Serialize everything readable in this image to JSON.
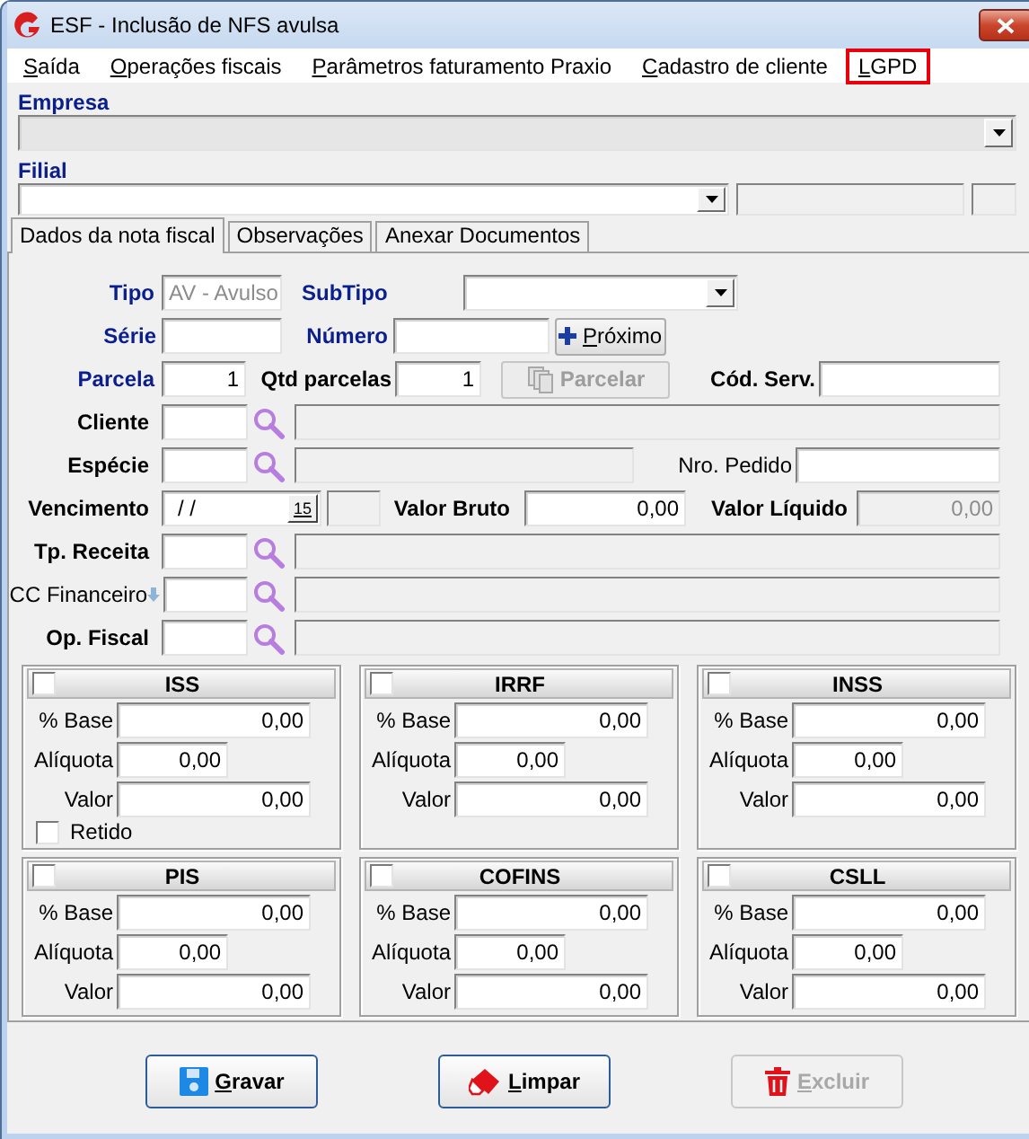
{
  "window": {
    "title": "ESF - Inclusão de NFS avulsa"
  },
  "menu": [
    {
      "label": "Saída",
      "highlighted": false
    },
    {
      "label": "Operações fiscais",
      "highlighted": false
    },
    {
      "label": "Parâmetros faturamento Praxio",
      "highlighted": false
    },
    {
      "label": "Cadastro de cliente",
      "highlighted": false
    },
    {
      "label": "LGPD",
      "highlighted": true
    }
  ],
  "empresa": {
    "label": "Empresa",
    "disabled": true
  },
  "filial": {
    "label": "Filial",
    "disabled": false
  },
  "tabs": [
    {
      "label": "Dados da nota fiscal",
      "selected": true
    },
    {
      "label": "Observações",
      "selected": false
    },
    {
      "label": "Anexar Documentos",
      "selected": false
    }
  ],
  "rows": [
    [
      {
        "kind": "label",
        "text": "Tipo"
      },
      {
        "kind": "input",
        "value": "AV - Avulso",
        "disabled": true
      },
      {
        "kind": "label",
        "text": "SubTipo"
      },
      {
        "kind": "combo"
      }
    ],
    [
      {
        "kind": "label",
        "text": "Série"
      },
      {
        "kind": "input"
      },
      {
        "kind": "label",
        "text": "Número"
      },
      {
        "kind": "input"
      },
      {
        "kind": "button",
        "label": "Próximo",
        "disabled": false
      }
    ],
    [
      {
        "kind": "label",
        "text": "Parcela"
      },
      {
        "kind": "input",
        "value": "1",
        "disabled": false
      },
      {
        "kind": "label",
        "text": "Qtd parcelas"
      },
      {
        "kind": "input",
        "value": "1",
        "disabled": false
      },
      {
        "kind": "button",
        "label": "Parcelar",
        "disabled": true
      },
      {
        "kind": "label",
        "text": "Cód. Serv."
      },
      {
        "kind": "input"
      }
    ],
    [
      {
        "kind": "label",
        "text": "Cliente"
      },
      {
        "kind": "input"
      },
      {
        "kind": "lookup"
      },
      {
        "kind": "display"
      }
    ],
    [
      {
        "kind": "label",
        "text": "Espécie"
      },
      {
        "kind": "input"
      },
      {
        "kind": "lookup"
      },
      {
        "kind": "display"
      },
      {
        "kind": "label",
        "text": "Nro. Pedido"
      },
      {
        "kind": "input"
      }
    ],
    [
      {
        "kind": "label",
        "text": "Vencimento"
      },
      {
        "kind": "date",
        "value": "/ /",
        "calendar": "15"
      },
      {
        "kind": "display"
      },
      {
        "kind": "label",
        "text": "Valor Bruto"
      },
      {
        "kind": "input",
        "value": "0,00",
        "disabled": false
      },
      {
        "kind": "label",
        "text": "Valor Líquido"
      },
      {
        "kind": "input",
        "value": "0,00",
        "disabled": true
      }
    ],
    [
      {
        "kind": "label",
        "text": "Tp. Receita"
      },
      {
        "kind": "input"
      },
      {
        "kind": "lookup"
      },
      {
        "kind": "display"
      }
    ],
    [
      {
        "kind": "label",
        "text": "CC Financeiro"
      },
      {
        "kind": "input"
      },
      {
        "kind": "lookup"
      },
      {
        "kind": "display"
      }
    ],
    [
      {
        "kind": "label",
        "text": "Op. Fiscal"
      },
      {
        "kind": "input"
      },
      {
        "kind": "lookup"
      },
      {
        "kind": "display"
      }
    ]
  ],
  "taxes": [
    {
      "name": "ISS",
      "checked": false,
      "fields": [
        {
          "label": "% Base",
          "value": "0,00"
        },
        {
          "label": "Alíquota",
          "value": "0,00"
        },
        {
          "label": "Valor",
          "value": "0,00"
        }
      ],
      "retido": {
        "label": "Retido",
        "checked": false
      }
    },
    {
      "name": "IRRF",
      "checked": false,
      "fields": [
        {
          "label": "% Base",
          "value": "0,00"
        },
        {
          "label": "Alíquota",
          "value": "0,00"
        },
        {
          "label": "Valor",
          "value": "0,00"
        }
      ]
    },
    {
      "name": "INSS",
      "checked": false,
      "fields": [
        {
          "label": "% Base",
          "value": "0,00"
        },
        {
          "label": "Alíquota",
          "value": "0,00"
        },
        {
          "label": "Valor",
          "value": "0,00"
        }
      ]
    },
    {
      "name": "PIS",
      "checked": false,
      "fields": [
        {
          "label": "% Base",
          "value": "0,00"
        },
        {
          "label": "Alíquota",
          "value": "0,00"
        },
        {
          "label": "Valor",
          "value": "0,00"
        }
      ]
    },
    {
      "name": "COFINS",
      "checked": false,
      "fields": [
        {
          "label": "% Base",
          "value": "0,00"
        },
        {
          "label": "Alíquota",
          "value": "0,00"
        },
        {
          "label": "Valor",
          "value": "0,00"
        }
      ]
    },
    {
      "name": "CSLL",
      "checked": false,
      "fields": [
        {
          "label": "% Base",
          "value": "0,00"
        },
        {
          "label": "Alíquota",
          "value": "0,00"
        },
        {
          "label": "Valor",
          "value": "0,00"
        }
      ]
    }
  ],
  "actions": [
    {
      "label": "Gravar",
      "disabled": false
    },
    {
      "label": "Limpar",
      "disabled": false
    },
    {
      "label": "Excluir",
      "disabled": true
    }
  ]
}
